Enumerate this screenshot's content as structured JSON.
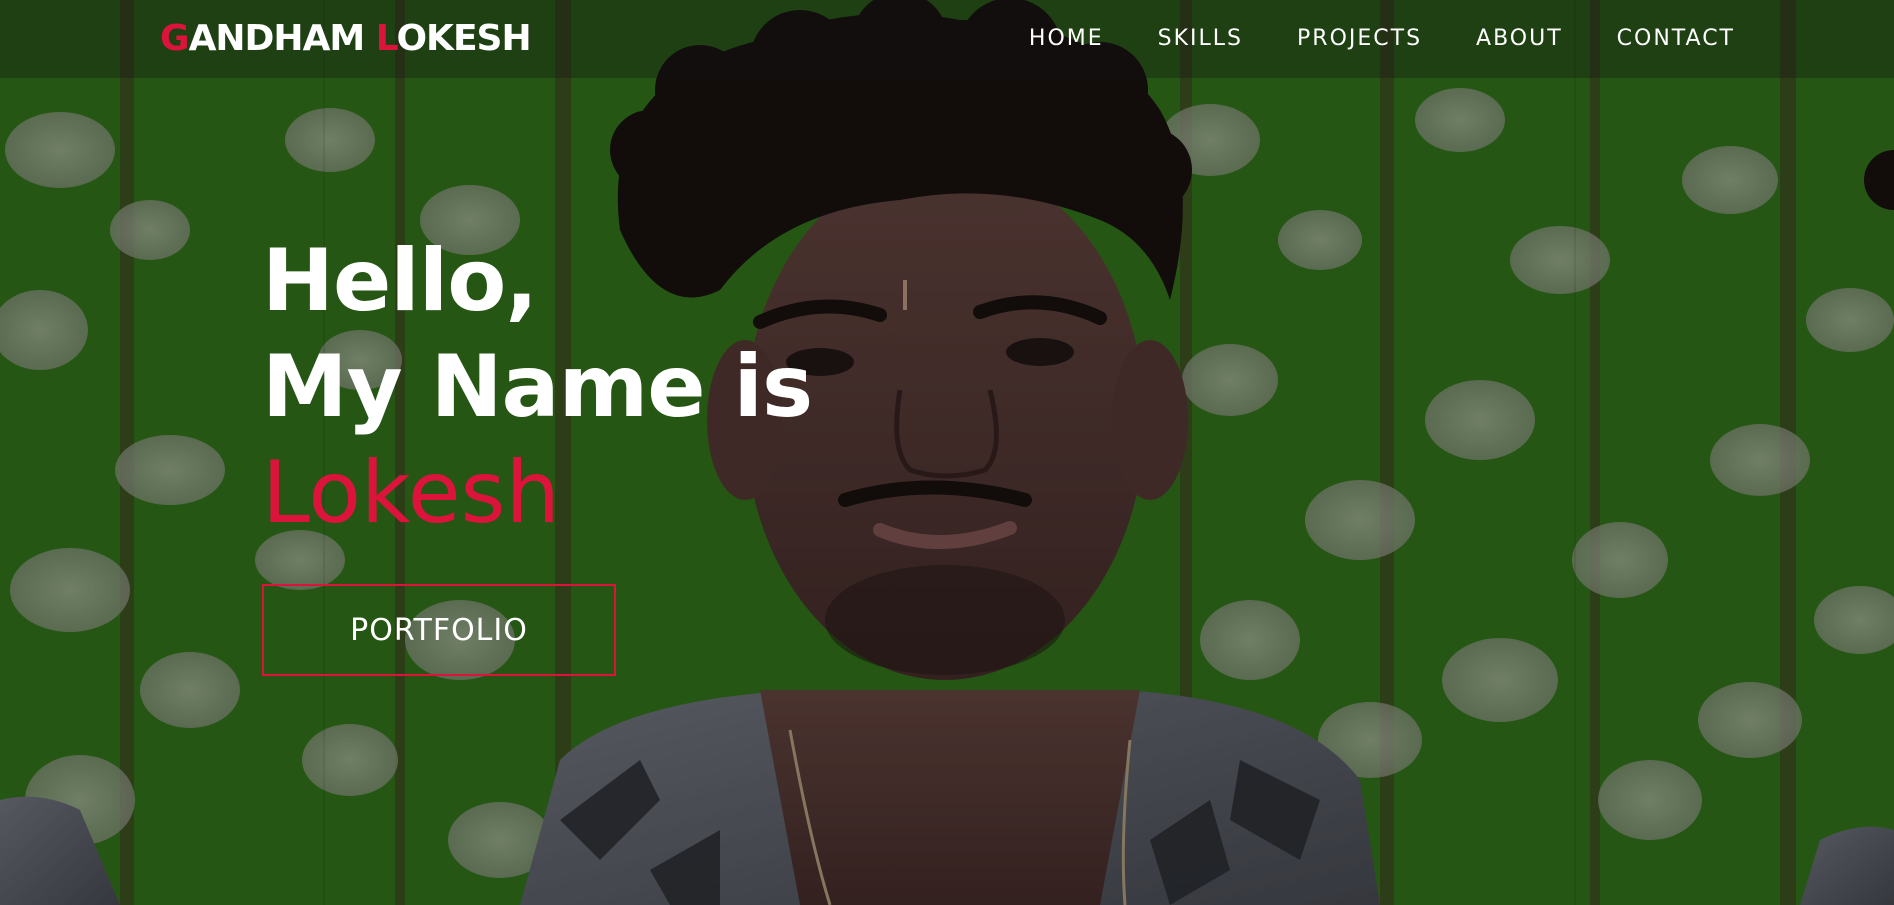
{
  "logo": {
    "first_initial": "G",
    "first_rest": "ANDHAM ",
    "last_initial": "L",
    "last_rest": "OKESH"
  },
  "nav": {
    "items": [
      {
        "label": "HOME"
      },
      {
        "label": "SKILLS"
      },
      {
        "label": "PROJECTS"
      },
      {
        "label": "ABOUT"
      },
      {
        "label": "CONTACT"
      }
    ]
  },
  "hero": {
    "line1": "Hello,",
    "line2": "My Name is",
    "line3": "Lokesh",
    "button_label": "PORTFOLIO"
  },
  "colors": {
    "accent": "#dc143c",
    "text": "#ffffff",
    "background_green": "#2f6a1c"
  }
}
